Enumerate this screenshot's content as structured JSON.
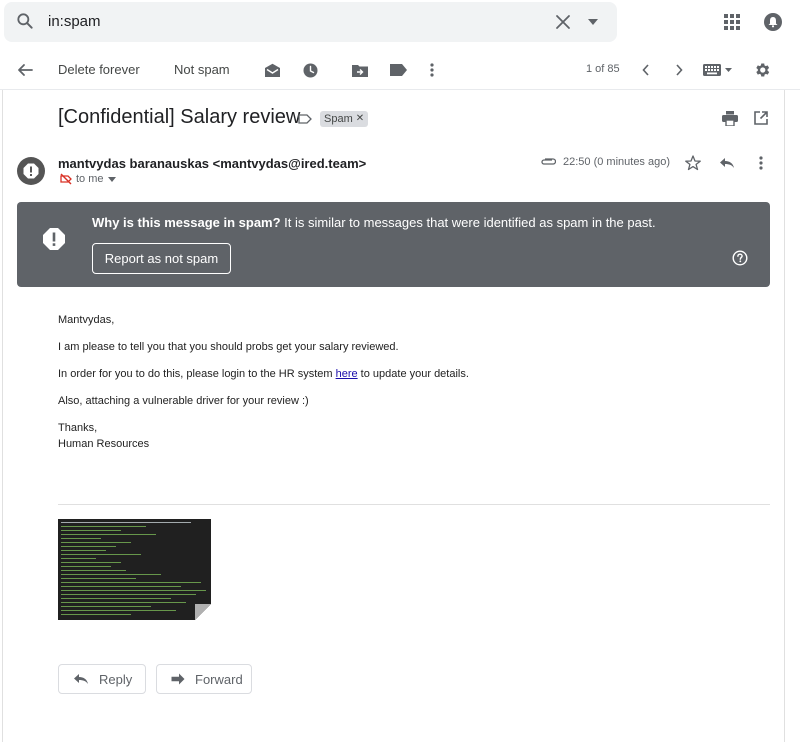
{
  "search": {
    "query": "in:spam"
  },
  "toolbar": {
    "delete_forever": "Delete forever",
    "not_spam": "Not spam",
    "pager": "1 of 85"
  },
  "message": {
    "subject": "[Confidential] Salary review",
    "label": "Spam",
    "sender": "mantvydas baranauskas <mantvydas@ired.team>",
    "recipient": "to me",
    "timestamp": "22:50 (0 minutes ago)"
  },
  "spam_banner": {
    "title": "Why is this message in spam?",
    "reason": " It is similar to messages that were identified as spam in the past.",
    "report_button": "Report as not spam"
  },
  "body": {
    "greeting": "Mantvydas,",
    "line1": "I am please to tell you that you should probs get your salary reviewed.",
    "line2_pre": "In order for you to do this, please login to the HR system ",
    "line2_link": "here",
    "line2_post": " to update your details.",
    "line3": "Also, attaching a vulnerable driver for your review :)",
    "signoff": "Thanks,",
    "signature": "Human Resources"
  },
  "actions": {
    "reply": "Reply",
    "forward": "Forward"
  },
  "colors": {
    "banner_bg": "#5f6368",
    "link": "#1a0dab",
    "search_bg": "#f1f3f4"
  }
}
